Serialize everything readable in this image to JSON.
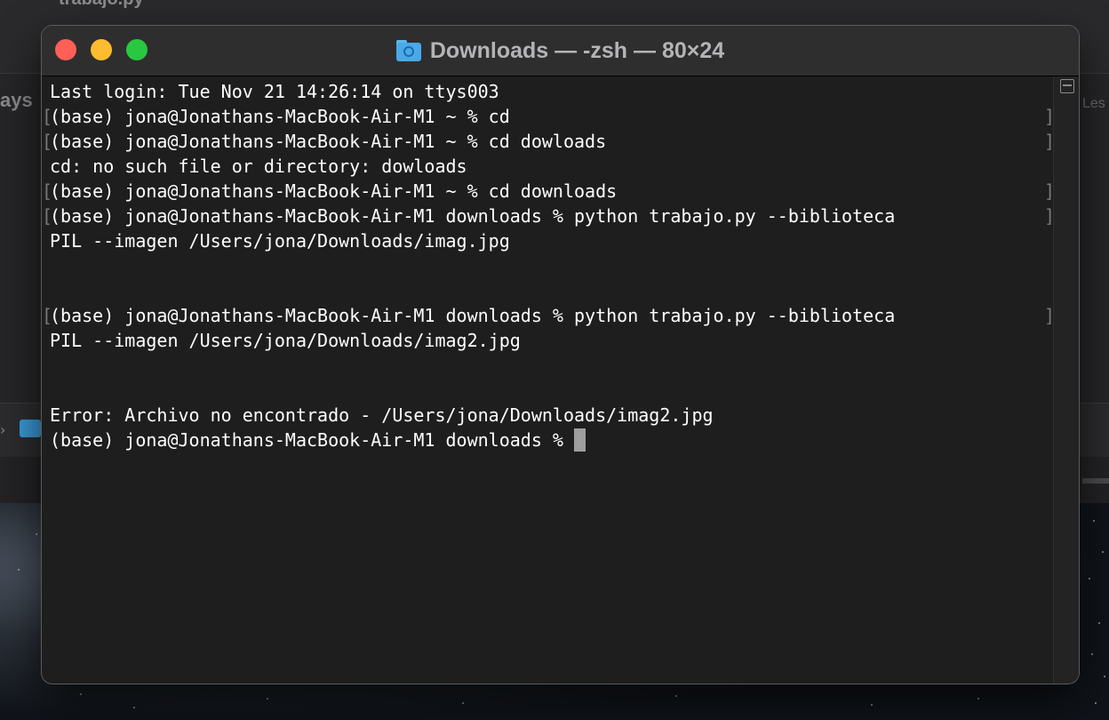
{
  "background": {
    "top_title": "trabajo.py",
    "left_text": "ays",
    "right_text": "Les"
  },
  "window": {
    "title": "Downloads — -zsh — 80×24",
    "title_icon": "downloads-folder-icon",
    "colors": {
      "close": "#ff5f57",
      "minimize": "#febc2e",
      "zoom": "#28c840",
      "background": "#1e1e1e",
      "text": "#ffffff"
    }
  },
  "terminal": {
    "lines": [
      {
        "text": "Last login: Tue Nov 21 14:26:14 on ttys003",
        "marked": false
      },
      {
        "text": "(base) jona@Jonathans-MacBook-Air-M1 ~ % cd",
        "marked": true
      },
      {
        "text": "(base) jona@Jonathans-MacBook-Air-M1 ~ % cd dowloads",
        "marked": true
      },
      {
        "text": "cd: no such file or directory: dowloads",
        "marked": false
      },
      {
        "text": "(base) jona@Jonathans-MacBook-Air-M1 ~ % cd downloads",
        "marked": true
      },
      {
        "text": "(base) jona@Jonathans-MacBook-Air-M1 downloads % python trabajo.py --biblioteca",
        "marked": true
      },
      {
        "text": "PIL --imagen /Users/jona/Downloads/imag.jpg",
        "marked": false
      },
      {
        "text": "",
        "marked": false
      },
      {
        "text": "",
        "marked": false
      },
      {
        "text": "(base) jona@Jonathans-MacBook-Air-M1 downloads % python trabajo.py --biblioteca",
        "marked": true
      },
      {
        "text": "PIL --imagen /Users/jona/Downloads/imag2.jpg",
        "marked": false
      },
      {
        "text": "",
        "marked": false
      },
      {
        "text": "",
        "marked": false
      },
      {
        "text": "Error: Archivo no encontrado - /Users/jona/Downloads/imag2.jpg",
        "marked": false
      }
    ],
    "prompt": "(base) jona@Jonathans-MacBook-Air-M1 downloads % "
  }
}
